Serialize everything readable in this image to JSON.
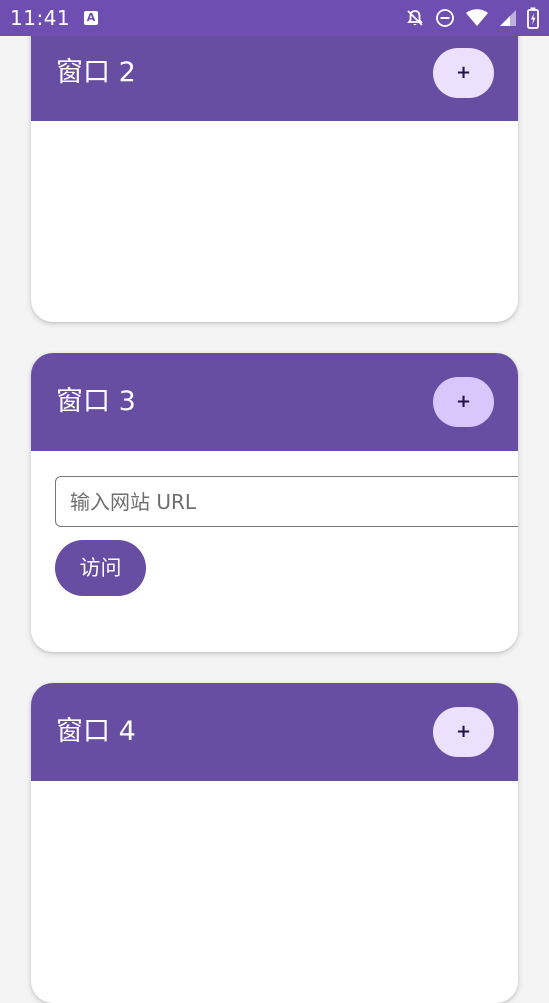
{
  "status_bar": {
    "time": "11:41",
    "app_icon_letter": "A",
    "background": "#6f4eb1",
    "icons": [
      "notifications-off-icon",
      "do-not-disturb-icon",
      "wifi-icon",
      "signal-icon",
      "battery-charging-icon"
    ]
  },
  "windows": [
    {
      "title": "窗口 2",
      "add_label": "+"
    },
    {
      "title": "窗口 3",
      "add_label": "+",
      "url_placeholder": "输入网站 URL",
      "visit_label": "访问"
    },
    {
      "title": "窗口 4",
      "add_label": "+"
    }
  ],
  "colors": {
    "header": "#674ea3",
    "add_button": "#ebe1fd",
    "add_button_pressed": "#d9c7fb",
    "page_background": "#f4f4f4"
  }
}
